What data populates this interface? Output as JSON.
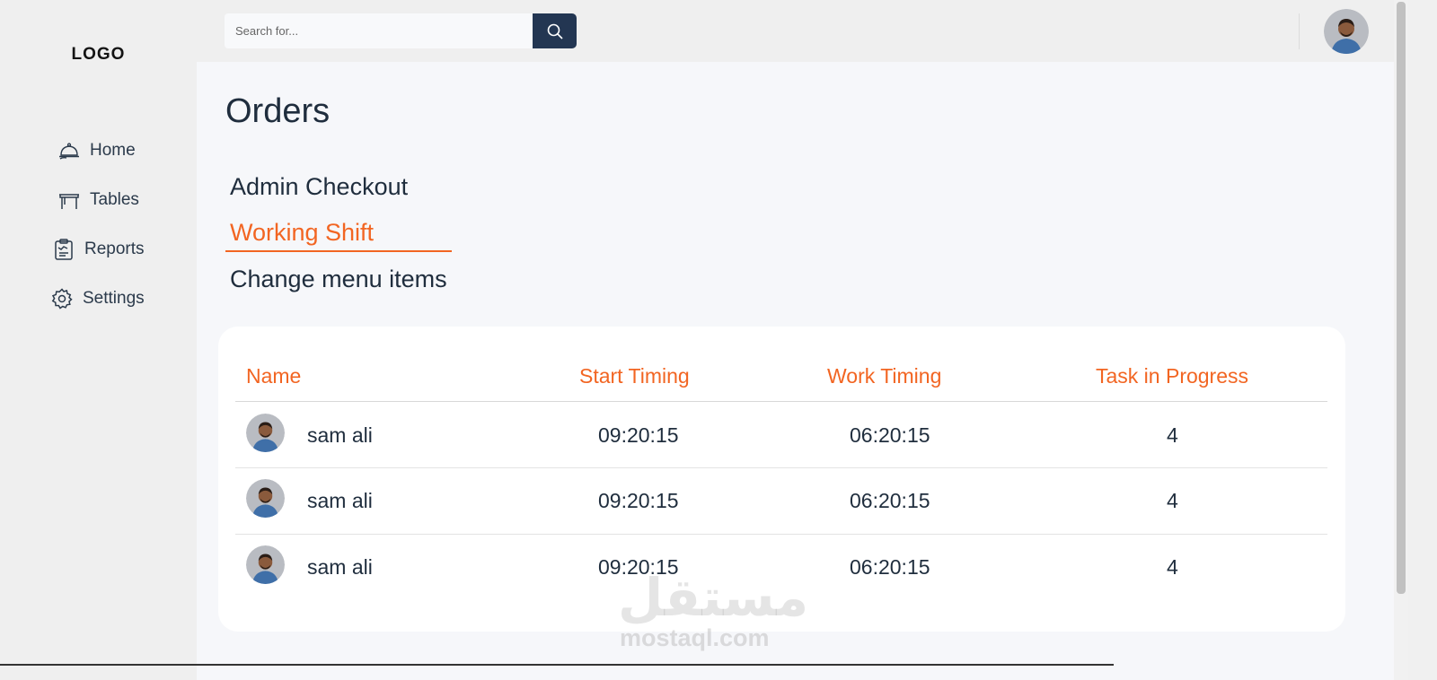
{
  "sidebar": {
    "logo": "LOGO",
    "items": [
      {
        "label": "Home",
        "icon": "food-cloche-icon"
      },
      {
        "label": "Tables",
        "icon": "table-icon"
      },
      {
        "label": "Reports",
        "icon": "clipboard-report-icon"
      },
      {
        "label": "Settings",
        "icon": "gear-icon"
      }
    ]
  },
  "topbar": {
    "search_placeholder": "Search for...",
    "search_icon": "search-icon",
    "user_avatar": "user-avatar"
  },
  "main": {
    "title": "Orders",
    "tabs": [
      {
        "label": "Admin Checkout",
        "active": false
      },
      {
        "label": "Working Shift",
        "active": true
      },
      {
        "label": "Change menu items",
        "active": false
      }
    ],
    "table": {
      "columns": [
        "Name",
        "Start Timing",
        "Work Timing",
        "Task in Progress"
      ],
      "rows": [
        {
          "name": "sam ali",
          "start": "09:20:15",
          "work": "06:20:15",
          "tasks": "4"
        },
        {
          "name": "sam ali",
          "start": "09:20:15",
          "work": "06:20:15",
          "tasks": "4"
        },
        {
          "name": "sam ali",
          "start": "09:20:15",
          "work": "06:20:15",
          "tasks": "4"
        }
      ]
    }
  },
  "watermark": {
    "arabic": "مستقل",
    "latin": "mostaql.com"
  },
  "colors": {
    "accent": "#f26522",
    "primary": "#233652",
    "text": "#1f2d3d"
  }
}
